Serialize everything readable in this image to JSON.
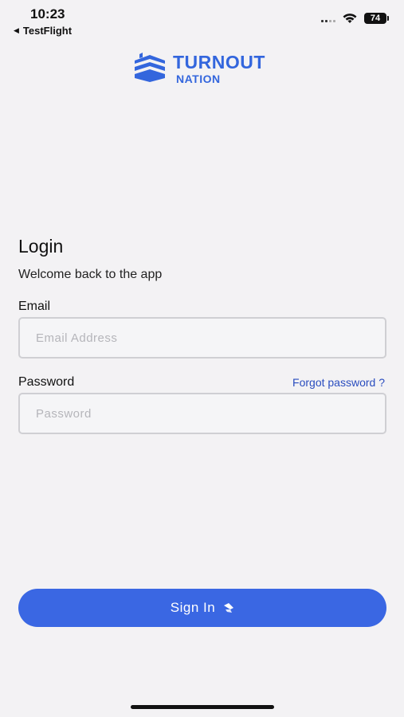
{
  "status_bar": {
    "time": "10:23",
    "back_app": "TestFlight",
    "battery": "74"
  },
  "logo": {
    "title": "TURNOUT",
    "subtitle": "NATION",
    "brand_color": "#3366dd"
  },
  "login": {
    "title": "Login",
    "welcome": "Welcome back to the app",
    "email_label": "Email",
    "email_placeholder": "Email Address",
    "email_value": "",
    "password_label": "Password",
    "forgot_label": "Forgot password ?",
    "password_placeholder": "Password",
    "password_value": "",
    "signin_label": "Sign In",
    "button_color": "#3a67e3"
  },
  "icons": {
    "back": "back-arrow-icon",
    "signal": "cellular-signal-icon",
    "wifi": "wifi-icon",
    "battery": "battery-icon",
    "signin": "arrow-icon"
  }
}
